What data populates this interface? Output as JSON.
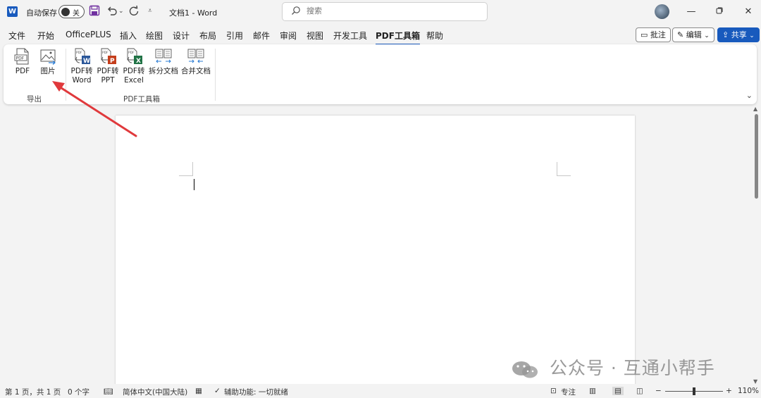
{
  "titlebar": {
    "app_icon_letter": "W",
    "autosave_label": "自动保存",
    "autosave_state": "关",
    "doc_title": "文档1 - Word",
    "search_placeholder": "搜索",
    "window_controls": [
      "minimize-icon",
      "restore-icon",
      "close-icon"
    ]
  },
  "menu": {
    "tabs": [
      "文件",
      "开始",
      "OfficePLUS",
      "插入",
      "绘图",
      "设计",
      "布局",
      "引用",
      "邮件",
      "审阅",
      "视图",
      "开发工具",
      "PDF工具箱",
      "帮助"
    ],
    "active_tab": "PDF工具箱",
    "comment_button": "批注",
    "edit_button": "编辑",
    "share_button": "共享"
  },
  "ribbon": {
    "groups": [
      {
        "label": "导出",
        "buttons": [
          {
            "label": "PDF",
            "icon": "pdf-export-icon"
          },
          {
            "label": "图片",
            "icon": "image-export-icon"
          }
        ]
      },
      {
        "label": "PDF工具箱",
        "buttons": [
          {
            "label1": "PDF转",
            "label2": "Word",
            "icon": "pdf-to-word-icon"
          },
          {
            "label1": "PDF转",
            "label2": "PPT",
            "icon": "pdf-to-ppt-icon"
          },
          {
            "label1": "PDF转",
            "label2": "Excel",
            "icon": "pdf-to-excel-icon"
          },
          {
            "label1": "拆分文档",
            "icon": "split-doc-icon"
          },
          {
            "label1": "合并文档",
            "icon": "merge-doc-icon"
          }
        ]
      }
    ]
  },
  "watermark": {
    "text": "公众号 · 互通小帮手"
  },
  "statusbar": {
    "page": "第 1 页，共 1 页",
    "words": "0 个字",
    "language": "简体中文(中国大陆)",
    "accessibility": "辅助功能: 一切就绪",
    "focus": "专注",
    "zoom": "110%"
  },
  "colors": {
    "accent": "#185abd",
    "annotation_arrow": "#e0393c",
    "word_blue": "#2b579a",
    "ppt_red": "#c43e1c",
    "excel_green": "#217346"
  }
}
